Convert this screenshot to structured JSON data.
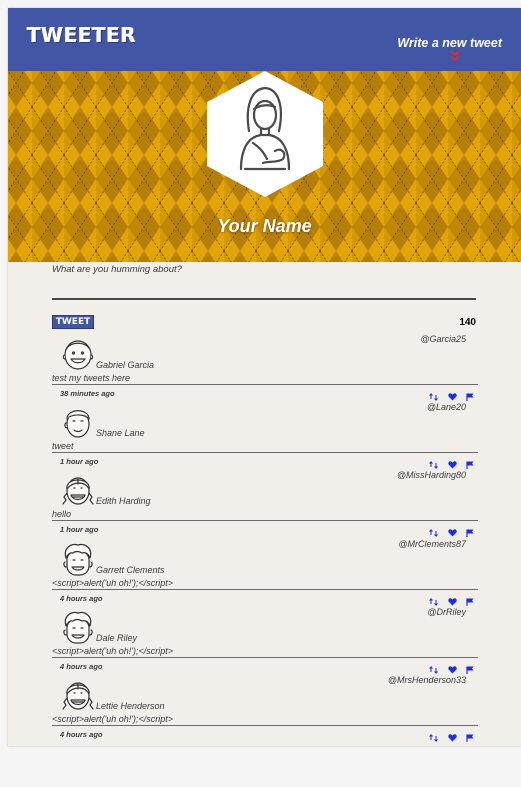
{
  "nav": {
    "logo": "TWEETER",
    "write_link": "Write a new tweet",
    "chevron_color": "#e0253d"
  },
  "profile": {
    "name": "Your Name"
  },
  "compose": {
    "prompt": "What are you humming about?",
    "tweet_button": "TWEET",
    "char_count": "140"
  },
  "colors": {
    "nav": "#4156a4",
    "hero_base": "#e2a406",
    "action_icons": "#1a2ee8"
  },
  "tweets": [
    {
      "name": "Gabriel Garcia",
      "handle": "@Garcia25",
      "message": "test my tweets here",
      "time": "38 minutes ago",
      "avatar": "smiling-man-avatar"
    },
    {
      "name": "Shane Lane",
      "handle": "@Lane20",
      "message": "tweet",
      "time": "1 hour ago",
      "avatar": "young-man-avatar"
    },
    {
      "name": "Edith Harding",
      "handle": "@MissHarding80",
      "message": "hello",
      "time": "1 hour ago",
      "avatar": "braided-girl-avatar"
    },
    {
      "name": "Garrett Clements",
      "handle": "@MrClements87",
      "message": "<script>alert('uh oh!');</script>",
      "time": "4 hours ago",
      "avatar": "curly-hair-man-avatar"
    },
    {
      "name": "Dale Riley",
      "handle": "@DrRiley",
      "message": "<script>alert('uh oh!');</script>",
      "time": "4 hours ago",
      "avatar": "curly-hair-man-avatar"
    },
    {
      "name": "Lettie Henderson",
      "handle": "@MrsHenderson33",
      "message": "<script>alert('uh oh!');</script>",
      "time": "4 hours ago",
      "avatar": "braided-girl-avatar"
    },
    {
      "name": "",
      "handle": "",
      "message": "",
      "time": "4 hours ago",
      "avatar": "partial-avatar"
    }
  ]
}
